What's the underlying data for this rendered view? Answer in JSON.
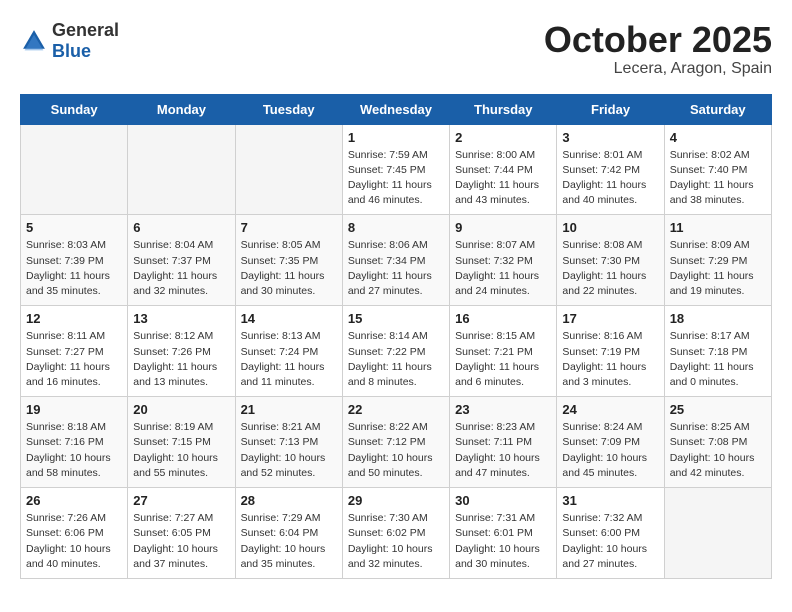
{
  "logo": {
    "text_general": "General",
    "text_blue": "Blue"
  },
  "title": "October 2025",
  "subtitle": "Lecera, Aragon, Spain",
  "weekdays": [
    "Sunday",
    "Monday",
    "Tuesday",
    "Wednesday",
    "Thursday",
    "Friday",
    "Saturday"
  ],
  "weeks": [
    [
      {
        "day": "",
        "info": ""
      },
      {
        "day": "",
        "info": ""
      },
      {
        "day": "",
        "info": ""
      },
      {
        "day": "1",
        "info": "Sunrise: 7:59 AM\nSunset: 7:45 PM\nDaylight: 11 hours and 46 minutes."
      },
      {
        "day": "2",
        "info": "Sunrise: 8:00 AM\nSunset: 7:44 PM\nDaylight: 11 hours and 43 minutes."
      },
      {
        "day": "3",
        "info": "Sunrise: 8:01 AM\nSunset: 7:42 PM\nDaylight: 11 hours and 40 minutes."
      },
      {
        "day": "4",
        "info": "Sunrise: 8:02 AM\nSunset: 7:40 PM\nDaylight: 11 hours and 38 minutes."
      }
    ],
    [
      {
        "day": "5",
        "info": "Sunrise: 8:03 AM\nSunset: 7:39 PM\nDaylight: 11 hours and 35 minutes."
      },
      {
        "day": "6",
        "info": "Sunrise: 8:04 AM\nSunset: 7:37 PM\nDaylight: 11 hours and 32 minutes."
      },
      {
        "day": "7",
        "info": "Sunrise: 8:05 AM\nSunset: 7:35 PM\nDaylight: 11 hours and 30 minutes."
      },
      {
        "day": "8",
        "info": "Sunrise: 8:06 AM\nSunset: 7:34 PM\nDaylight: 11 hours and 27 minutes."
      },
      {
        "day": "9",
        "info": "Sunrise: 8:07 AM\nSunset: 7:32 PM\nDaylight: 11 hours and 24 minutes."
      },
      {
        "day": "10",
        "info": "Sunrise: 8:08 AM\nSunset: 7:30 PM\nDaylight: 11 hours and 22 minutes."
      },
      {
        "day": "11",
        "info": "Sunrise: 8:09 AM\nSunset: 7:29 PM\nDaylight: 11 hours and 19 minutes."
      }
    ],
    [
      {
        "day": "12",
        "info": "Sunrise: 8:11 AM\nSunset: 7:27 PM\nDaylight: 11 hours and 16 minutes."
      },
      {
        "day": "13",
        "info": "Sunrise: 8:12 AM\nSunset: 7:26 PM\nDaylight: 11 hours and 13 minutes."
      },
      {
        "day": "14",
        "info": "Sunrise: 8:13 AM\nSunset: 7:24 PM\nDaylight: 11 hours and 11 minutes."
      },
      {
        "day": "15",
        "info": "Sunrise: 8:14 AM\nSunset: 7:22 PM\nDaylight: 11 hours and 8 minutes."
      },
      {
        "day": "16",
        "info": "Sunrise: 8:15 AM\nSunset: 7:21 PM\nDaylight: 11 hours and 6 minutes."
      },
      {
        "day": "17",
        "info": "Sunrise: 8:16 AM\nSunset: 7:19 PM\nDaylight: 11 hours and 3 minutes."
      },
      {
        "day": "18",
        "info": "Sunrise: 8:17 AM\nSunset: 7:18 PM\nDaylight: 11 hours and 0 minutes."
      }
    ],
    [
      {
        "day": "19",
        "info": "Sunrise: 8:18 AM\nSunset: 7:16 PM\nDaylight: 10 hours and 58 minutes."
      },
      {
        "day": "20",
        "info": "Sunrise: 8:19 AM\nSunset: 7:15 PM\nDaylight: 10 hours and 55 minutes."
      },
      {
        "day": "21",
        "info": "Sunrise: 8:21 AM\nSunset: 7:13 PM\nDaylight: 10 hours and 52 minutes."
      },
      {
        "day": "22",
        "info": "Sunrise: 8:22 AM\nSunset: 7:12 PM\nDaylight: 10 hours and 50 minutes."
      },
      {
        "day": "23",
        "info": "Sunrise: 8:23 AM\nSunset: 7:11 PM\nDaylight: 10 hours and 47 minutes."
      },
      {
        "day": "24",
        "info": "Sunrise: 8:24 AM\nSunset: 7:09 PM\nDaylight: 10 hours and 45 minutes."
      },
      {
        "day": "25",
        "info": "Sunrise: 8:25 AM\nSunset: 7:08 PM\nDaylight: 10 hours and 42 minutes."
      }
    ],
    [
      {
        "day": "26",
        "info": "Sunrise: 7:26 AM\nSunset: 6:06 PM\nDaylight: 10 hours and 40 minutes."
      },
      {
        "day": "27",
        "info": "Sunrise: 7:27 AM\nSunset: 6:05 PM\nDaylight: 10 hours and 37 minutes."
      },
      {
        "day": "28",
        "info": "Sunrise: 7:29 AM\nSunset: 6:04 PM\nDaylight: 10 hours and 35 minutes."
      },
      {
        "day": "29",
        "info": "Sunrise: 7:30 AM\nSunset: 6:02 PM\nDaylight: 10 hours and 32 minutes."
      },
      {
        "day": "30",
        "info": "Sunrise: 7:31 AM\nSunset: 6:01 PM\nDaylight: 10 hours and 30 minutes."
      },
      {
        "day": "31",
        "info": "Sunrise: 7:32 AM\nSunset: 6:00 PM\nDaylight: 10 hours and 27 minutes."
      },
      {
        "day": "",
        "info": ""
      }
    ]
  ]
}
